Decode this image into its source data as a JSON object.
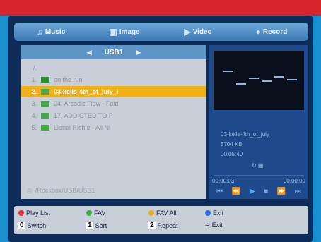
{
  "tabs": [
    {
      "label": "Music",
      "icon": "music-note-icon"
    },
    {
      "label": "Image",
      "icon": "image-icon"
    },
    {
      "label": "Video",
      "icon": "video-icon"
    },
    {
      "label": "Record",
      "icon": "record-icon"
    }
  ],
  "browser": {
    "device": "USB1",
    "rows": [
      {
        "num": "/.",
        "name": ""
      },
      {
        "num": "1.",
        "name": "on the run"
      },
      {
        "num": "2.",
        "name": "03-kells-4th_of_july_i"
      },
      {
        "num": "3.",
        "name": "04. Arcadic Flow - Fold"
      },
      {
        "num": "4.",
        "name": "17. ADDICTED TO P"
      },
      {
        "num": "5.",
        "name": "Lionel Richie - All Ni"
      }
    ],
    "path": "/Rockbox/USB/USB1"
  },
  "info": {
    "filename": "03-kells-4th_of_july",
    "size": "5704 KB",
    "duration": "00:05:40",
    "elapsed": "00:00:03",
    "total": "00:00:00"
  },
  "footer": {
    "play_list": "Play List",
    "fav": "FAV",
    "fav_all": "FAV All",
    "exit1": "Exit",
    "switch_key": "0",
    "switch": "Switch",
    "sort_key": "1",
    "sort": "Sort",
    "repeat_key": "2",
    "repeat": "Repeat",
    "exit2": "Exit"
  }
}
